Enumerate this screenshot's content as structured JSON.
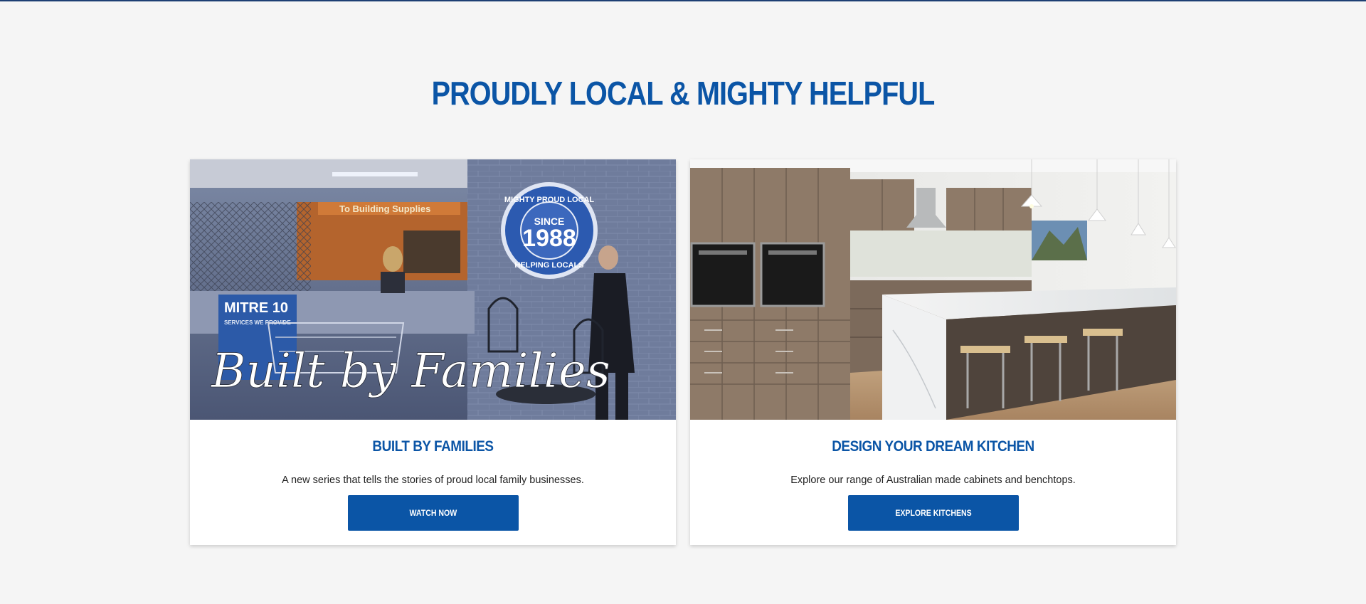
{
  "section": {
    "heading": "PROUDLY LOCAL & MIGHTY HELPFUL"
  },
  "cards": [
    {
      "title": "BUILT BY FAMILIES",
      "description": "A new series that tells the stories of proud local family businesses.",
      "button_label": "WATCH NOW",
      "image": {
        "overlay_script": "Built by Families",
        "badge_top": "MIGHTY PROUD LOCAL",
        "badge_since": "SINCE",
        "badge_year": "1988",
        "badge_bottom": "HELPING LOCALS",
        "store_sign": "MITRE 10",
        "store_sign_sub": "SERVICES WE PROVIDE",
        "banner_text": "To Building Supplies"
      }
    },
    {
      "title": "DESIGN YOUR DREAM KITCHEN",
      "description": "Explore our range of Australian made cabinets and benchtops.",
      "button_label": "EXPLORE KITCHENS"
    }
  ],
  "colors": {
    "brand_blue": "#0b55a6",
    "page_background": "#f5f5f5",
    "top_rule": "#1d3f73"
  }
}
